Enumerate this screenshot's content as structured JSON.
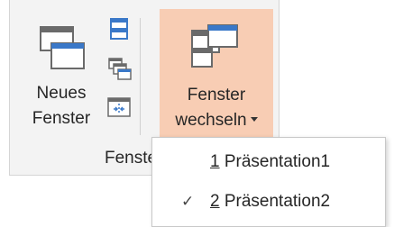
{
  "ribbon": {
    "group_label": "Fenster",
    "new_window": {
      "line1": "Neues",
      "line2": "Fenster",
      "icon": "new-window-icon"
    },
    "switch_window": {
      "line1": "Fenster",
      "line2": "wechseln",
      "icon": "switch-windows-icon"
    },
    "small_buttons": [
      {
        "icon": "arrange-all-icon"
      },
      {
        "icon": "cascade-icon"
      },
      {
        "icon": "move-split-icon"
      }
    ]
  },
  "dropdown": {
    "items": [
      {
        "accel": "1",
        "label": " Präsentation1",
        "checked": false
      },
      {
        "accel": "2",
        "label": " Präsentation2",
        "checked": true
      }
    ],
    "check_glyph": "✓"
  },
  "colors": {
    "hover_bg": "#f8cdb4",
    "ribbon_bg": "#f3f3f3",
    "icon_blue": "#3a78c8"
  }
}
